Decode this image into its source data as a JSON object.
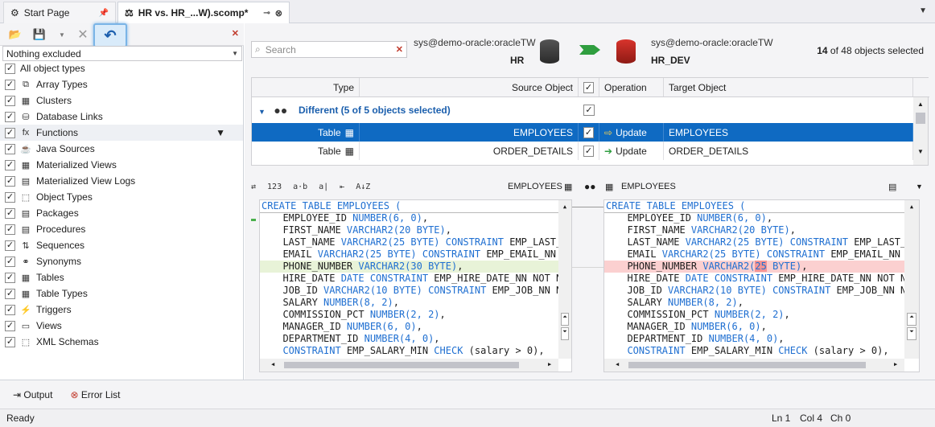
{
  "tabs": [
    {
      "label": "Start Page"
    },
    {
      "label": "HR vs. HR_...W).scomp*"
    }
  ],
  "left": {
    "exclusion": "Nothing excluded",
    "items": [
      {
        "label": "All object types",
        "icon": ""
      },
      {
        "label": "Array Types",
        "icon": "⧉"
      },
      {
        "label": "Clusters",
        "icon": "▦"
      },
      {
        "label": "Database Links",
        "icon": "⛁"
      },
      {
        "label": "Functions",
        "icon": "fx"
      },
      {
        "label": "Java Sources",
        "icon": "☕"
      },
      {
        "label": "Materialized Views",
        "icon": "▦"
      },
      {
        "label": "Materialized View Logs",
        "icon": "▤"
      },
      {
        "label": "Object Types",
        "icon": "⬚"
      },
      {
        "label": "Packages",
        "icon": "▤"
      },
      {
        "label": "Procedures",
        "icon": "▤"
      },
      {
        "label": "Sequences",
        "icon": "⇅"
      },
      {
        "label": "Synonyms",
        "icon": "⚭"
      },
      {
        "label": "Tables",
        "icon": "▦"
      },
      {
        "label": "Table Types",
        "icon": "▦"
      },
      {
        "label": "Triggers",
        "icon": "⚡"
      },
      {
        "label": "Views",
        "icon": "▭"
      },
      {
        "label": "XML Schemas",
        "icon": "⬚"
      }
    ]
  },
  "header": {
    "search_placeholder": "Search",
    "source_conn": "sys@demo-oracle:oracleTW",
    "source_db": "HR",
    "target_conn": "sys@demo-oracle:oracleTW",
    "target_db": "HR_DEV",
    "count_bold": "14",
    "count_rest": "of 48 objects selected"
  },
  "grid": {
    "cols": {
      "type": "Type",
      "source": "Source Object",
      "operation": "Operation",
      "target": "Target Object"
    },
    "group": "Different (5 of 5 objects selected)",
    "rows": [
      {
        "type": "Table",
        "source": "EMPLOYEES",
        "operation": "Update",
        "target": "EMPLOYEES"
      },
      {
        "type": "Table",
        "source": "ORDER_DETAILS",
        "operation": "Update",
        "target": "ORDER_DETAILS"
      }
    ]
  },
  "diff": {
    "left_title": "EMPLOYEES",
    "right_title": "EMPLOYEES",
    "tool_icons": [
      "⇄",
      "123",
      "a·b",
      "a|",
      "⇤",
      "A↓Z"
    ]
  },
  "code_left": [
    [
      "CREATE TABLE",
      " EMPLOYEES ("
    ],
    [
      "  EMPLOYEE_ID ",
      "NUMBER(6, 0)",
      ","
    ],
    [
      "  FIRST_NAME ",
      "VARCHAR2(20 BYTE)",
      ","
    ],
    [
      "  LAST_NAME ",
      "VARCHAR2(25 BYTE) CONSTRAINT",
      " EMP_LAST_NAM"
    ],
    [
      "  EMAIL ",
      "VARCHAR2(25 BYTE) CONSTRAINT",
      " EMP_EMAIL_NN NOT"
    ],
    [
      "  PHONE_NUMBER ",
      "VARCHAR2(",
      "30",
      " BYTE)",
      ","
    ],
    [
      "  HIRE_DATE ",
      "DATE CONSTRAINT",
      " EMP_HIRE_DATE_NN NOT NULL"
    ],
    [
      "  JOB_ID ",
      "VARCHAR2(10 BYTE) CONSTRAINT",
      " EMP_JOB_NN NOT"
    ],
    [
      "  SALARY ",
      "NUMBER(8, 2)",
      ","
    ],
    [
      "  COMMISSION_PCT ",
      "NUMBER(2, 2)",
      ","
    ],
    [
      "  MANAGER_ID ",
      "NUMBER(6, 0)",
      ","
    ],
    [
      "  DEPARTMENT_ID ",
      "NUMBER(4, 0)",
      ","
    ],
    [
      "  CONSTRAINT",
      " EMP_SALARY_MIN ",
      "CHECK",
      " (salary > 0),"
    ]
  ],
  "code_right": [
    [
      "CREATE TABLE",
      " EMPLOYEES ("
    ],
    [
      "  EMPLOYEE_ID ",
      "NUMBER(6, 0)",
      ","
    ],
    [
      "  FIRST_NAME ",
      "VARCHAR2(20 BYTE)",
      ","
    ],
    [
      "  LAST_NAME ",
      "VARCHAR2(25 BYTE) CONSTRAINT",
      " EMP_LAST_NAM"
    ],
    [
      "  EMAIL ",
      "VARCHAR2(25 BYTE) CONSTRAINT",
      " EMP_EMAIL_NN NOT"
    ],
    [
      "  PHONE_NUMBER ",
      "VARCHAR2(",
      "25",
      " BYTE)",
      ","
    ],
    [
      "  HIRE_DATE ",
      "DATE CONSTRAINT",
      " EMP_HIRE_DATE_NN NOT NULL"
    ],
    [
      "  JOB_ID ",
      "VARCHAR2(10 BYTE) CONSTRAINT",
      " EMP_JOB_NN NOT"
    ],
    [
      "  SALARY ",
      "NUMBER(8, 2)",
      ","
    ],
    [
      "  COMMISSION_PCT ",
      "NUMBER(2, 2)",
      ","
    ],
    [
      "  MANAGER_ID ",
      "NUMBER(6, 0)",
      ","
    ],
    [
      "  DEPARTMENT_ID ",
      "NUMBER(4, 0)",
      ","
    ],
    [
      "  CONSTRAINT",
      " EMP_SALARY_MIN ",
      "CHECK",
      " (salary > 0),"
    ]
  ],
  "bottom": {
    "output": "Output",
    "errors": "Error List"
  },
  "status": {
    "ready": "Ready",
    "ln": "Ln 1",
    "col": "Col 4",
    "ch": "Ch 0"
  }
}
